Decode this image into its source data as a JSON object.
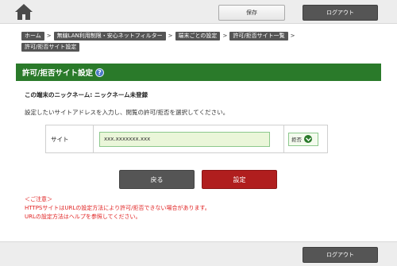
{
  "header": {
    "home_icon": "home-icon",
    "save_label": "保存",
    "logout_label": "ログアウト"
  },
  "breadcrumb": {
    "items": [
      {
        "label": "ホーム"
      },
      {
        "label": "無線LAN利用制限・安心ネットフィルター"
      },
      {
        "label": "端末ごとの設定"
      },
      {
        "label": "許可/拒否サイト一覧"
      },
      {
        "label": "許可/拒否サイト設定"
      }
    ],
    "separator": ">"
  },
  "page": {
    "title": "許可/拒否サイト設定",
    "help_label": "?",
    "title_bar_color": "#2a7a2a",
    "nickname_line": "この端末のニックネーム: ニックネーム未登録",
    "instruction": "設定したいサイトアドレスを入力し、閲覧の許可/拒否を選択してください。"
  },
  "form": {
    "site_label": "サイト",
    "site_value": "xxx.xxxxxxx.xxx",
    "permission_selected": "拒否",
    "permission_options": [
      "拒否"
    ]
  },
  "actions": {
    "back_label": "戻る",
    "set_label": "設定",
    "set_color": "#b01e1e"
  },
  "notes": {
    "heading": "＜ご注意＞",
    "line1": "HTTPSサイトはURLの設定方法により許可/拒否できない場合があります。",
    "line2": "URLの設定方法はヘルプを参照してください。",
    "color": "#e02020"
  },
  "footer": {
    "logout_label": "ログアウト"
  }
}
